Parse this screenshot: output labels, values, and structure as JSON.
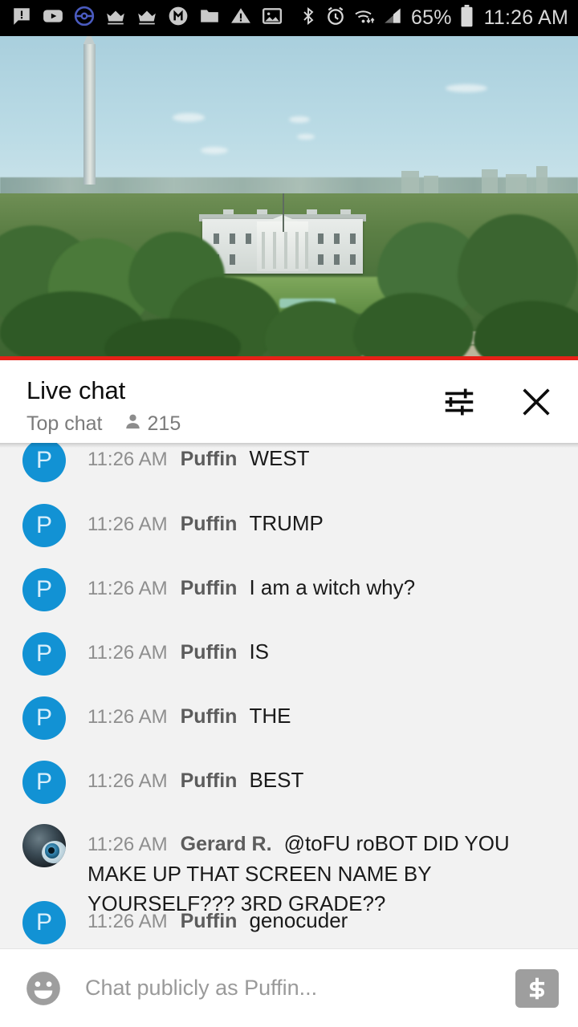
{
  "status_bar": {
    "notification_icons": [
      "message-alert-icon",
      "youtube-icon",
      "pokeball-icon",
      "crown-icon",
      "crown-icon",
      "m-circle-icon",
      "folder-icon",
      "warning-triangle-icon",
      "image-icon"
    ],
    "system_icons": [
      "bluetooth-icon",
      "alarm-icon",
      "wifi-icon",
      "cellular-signal-icon"
    ],
    "battery_percent": "65%",
    "battery_icon": "battery-icon",
    "clock": "11:26 AM"
  },
  "video": {
    "name": "live-video-player",
    "scene": "White House and Washington Monument live stream",
    "progress_color": "#e62117"
  },
  "chat_header": {
    "title": "Live chat",
    "subtitle": "Top chat",
    "viewer_icon": "person-icon",
    "viewer_count": "215",
    "settings_icon": "settings-sliders-icon",
    "close_icon": "close-icon"
  },
  "messages": [
    {
      "avatar_type": "letter",
      "avatar_letter": "P",
      "avatar_color": "#1292d4",
      "time": "11:26 AM",
      "author": "Puffin",
      "text": "WEST"
    },
    {
      "avatar_type": "letter",
      "avatar_letter": "P",
      "avatar_color": "#1292d4",
      "time": "11:26 AM",
      "author": "Puffin",
      "text": "TRUMP"
    },
    {
      "avatar_type": "letter",
      "avatar_letter": "P",
      "avatar_color": "#1292d4",
      "time": "11:26 AM",
      "author": "Puffin",
      "text": "I am a witch why?"
    },
    {
      "avatar_type": "letter",
      "avatar_letter": "P",
      "avatar_color": "#1292d4",
      "time": "11:26 AM",
      "author": "Puffin",
      "text": "IS"
    },
    {
      "avatar_type": "letter",
      "avatar_letter": "P",
      "avatar_color": "#1292d4",
      "time": "11:26 AM",
      "author": "Puffin",
      "text": "THE"
    },
    {
      "avatar_type": "letter",
      "avatar_letter": "P",
      "avatar_color": "#1292d4",
      "time": "11:26 AM",
      "author": "Puffin",
      "text": "BEST"
    },
    {
      "avatar_type": "photo",
      "avatar_letter": "",
      "avatar_color": "#2b3a44",
      "time": "11:26 AM",
      "author": "Gerard R.",
      "text": "@toFU roBOT DID YOU MAKE UP THAT SCREEN NAME BY YOURSELF??? 3RD GRADE??"
    },
    {
      "avatar_type": "letter",
      "avatar_letter": "P",
      "avatar_color": "#1292d4",
      "time": "11:26 AM",
      "author": "Puffin",
      "text": "genocuder"
    }
  ],
  "input_bar": {
    "emoji_icon": "emoji-smiley-icon",
    "placeholder": "Chat publicly as Puffin...",
    "superchat_icon": "dollar-sign-icon"
  }
}
